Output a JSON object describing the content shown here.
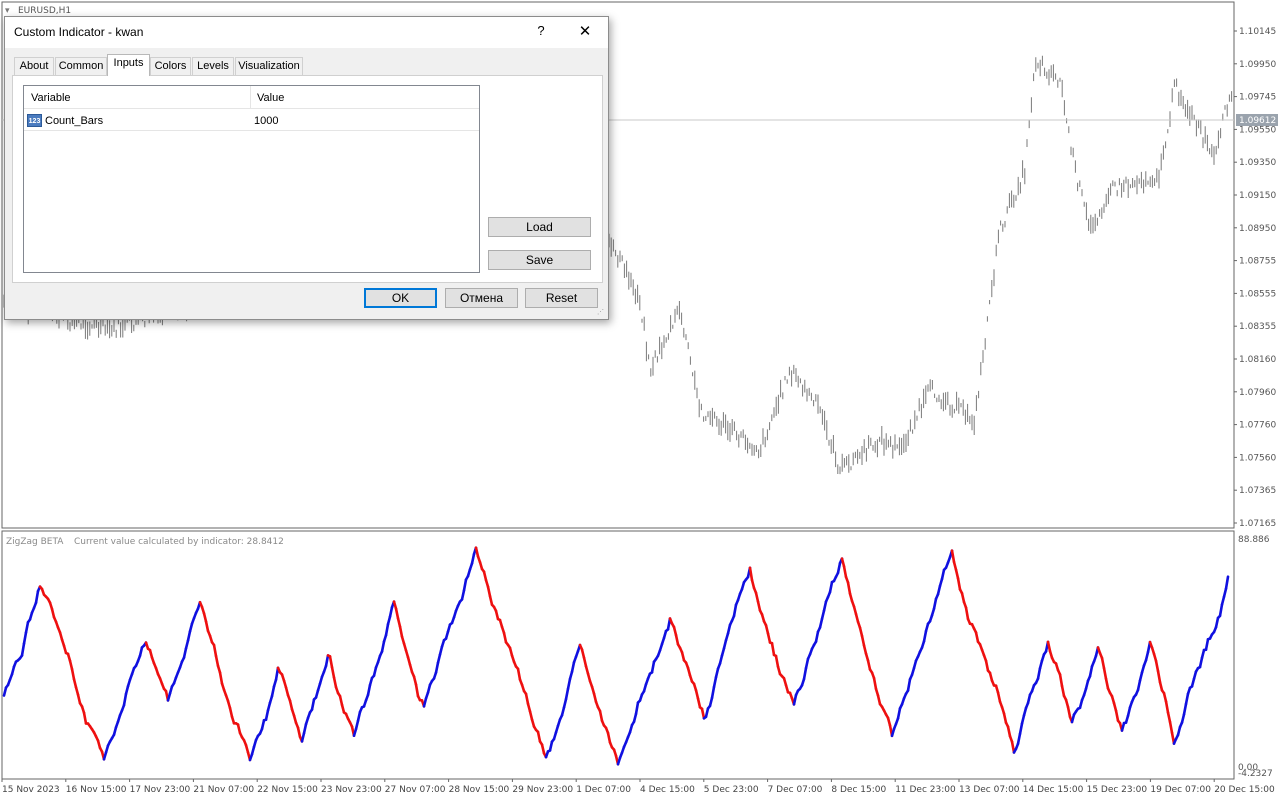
{
  "window": {
    "chart_tab": "EURUSD,H1"
  },
  "main_chart": {
    "price_labels": [
      "1.10145",
      "1.09950",
      "1.09745",
      "1.09550",
      "1.09350",
      "1.09150",
      "1.08950",
      "1.08755",
      "1.08555",
      "1.08355",
      "1.08160",
      "1.07960",
      "1.07760",
      "1.07560",
      "1.07365",
      "1.07165"
    ],
    "current_price": "1.09612",
    "current_price_bg": "#9aa3ad",
    "bar_color": "#7a7a7a"
  },
  "sub_chart": {
    "name": "ZigZag BETA",
    "value_text": "Current value calculated by indicator: 28.8412",
    "max_label": "88.886",
    "zero_label": "0.00",
    "min_label": "-4.2327",
    "up_color": "#1010e0",
    "down_color": "#ee1010"
  },
  "time_axis": {
    "labels": [
      "15 Nov 2023",
      "16 Nov 15:00",
      "17 Nov 23:00",
      "21 Nov 07:00",
      "22 Nov 15:00",
      "23 Nov 23:00",
      "27 Nov 07:00",
      "28 Nov 15:00",
      "29 Nov 23:00",
      "1 Dec 07:00",
      "4 Dec 15:00",
      "5 Dec 23:00",
      "7 Dec 07:00",
      "8 Dec 15:00",
      "11 Dec 23:00",
      "13 Dec 07:00",
      "14 Dec 15:00",
      "15 Dec 23:00",
      "19 Dec 07:00",
      "20 Dec 15:00"
    ]
  },
  "dialog": {
    "title": "Custom Indicator - kwan",
    "help_label": "?",
    "close_label": "✕",
    "tabs": [
      "About",
      "Common",
      "Inputs",
      "Colors",
      "Levels",
      "Visualization"
    ],
    "active_tab": "Inputs",
    "table": {
      "columns": [
        "Variable",
        "Value"
      ],
      "rows": [
        {
          "icon": "numeric-type-icon",
          "icon_text": "123",
          "variable": "Count_Bars",
          "value": "1000"
        }
      ]
    },
    "load_label": "Load",
    "save_label": "Save",
    "ok_label": "OK",
    "cancel_label": "Отмена",
    "reset_label": "Reset"
  }
}
